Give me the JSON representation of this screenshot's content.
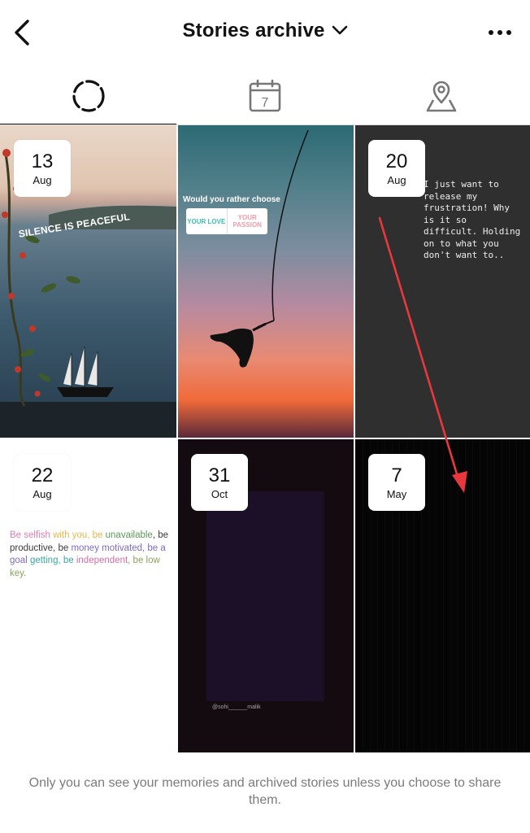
{
  "header": {
    "title": "Stories archive"
  },
  "icons": {
    "back": "chevron-left-icon",
    "title_dropdown": "chevron-down-icon",
    "more": "more-horizontal-icon",
    "tab_stories": "stories-ring-icon",
    "tab_calendar": "calendar-icon",
    "tab_map": "map-pin-icon"
  },
  "tabs": [
    {
      "name": "stories",
      "active": true
    },
    {
      "name": "calendar",
      "calendar_day": "7",
      "active": false
    },
    {
      "name": "map",
      "active": false
    }
  ],
  "stories": [
    {
      "day": "13",
      "month": "Aug",
      "overlay_text": "SILENCE IS PEACEFUL"
    },
    {
      "poll_question": "Would you rather choose",
      "option_a": "YOUR LOVE",
      "option_b": "YOUR PASSION"
    },
    {
      "day": "20",
      "month": "Aug",
      "text": "I just want to release my frustration! Why is it so difficult. Holding on to what you don't want to.."
    },
    {
      "day": "22",
      "month": "Aug",
      "quote_parts": [
        "Be selfish ",
        "with you, be ",
        "unavailable",
        ", be productive, be ",
        "money motivated, be a goal ",
        "getting, be ",
        "independent",
        ", be low key."
      ]
    },
    {
      "day": "31",
      "month": "Oct",
      "handle": "@sohi______malik"
    },
    {
      "day": "7",
      "month": "May"
    }
  ],
  "footer": {
    "text": "Only you can see your memories and archived stories unless you choose to share them."
  },
  "colors": {
    "annotation_arrow": "#e8383d",
    "text_primary": "#111111",
    "text_secondary": "#7b7b7b"
  }
}
